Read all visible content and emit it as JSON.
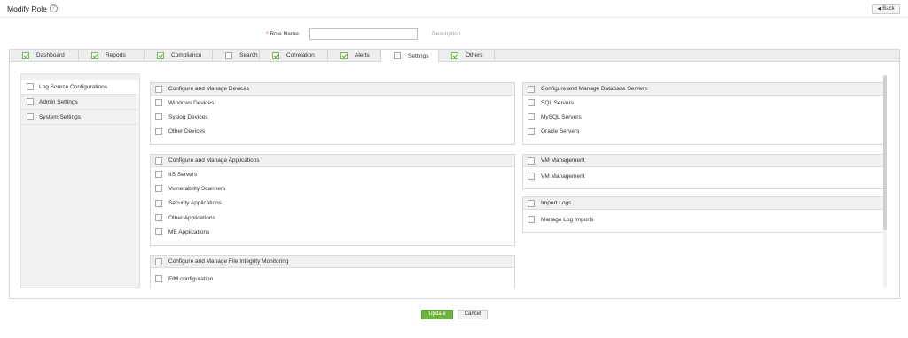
{
  "header": {
    "title": "Modify Role",
    "help_icon": "help-circle-icon",
    "back_label": "Back"
  },
  "role": {
    "name_label": "Role Name",
    "name_value": "",
    "description_label": "Description"
  },
  "tabs": [
    {
      "label": "Dashboard",
      "checked": true
    },
    {
      "label": "Reports",
      "checked": true
    },
    {
      "label": "Compliance",
      "checked": true
    },
    {
      "label": "Search",
      "checked": false
    },
    {
      "label": "Correlation",
      "checked": true
    },
    {
      "label": "Alerts",
      "checked": true
    },
    {
      "label": "Settings",
      "checked": false,
      "active": true
    },
    {
      "label": "Others",
      "checked": true
    }
  ],
  "sidebar": {
    "items": [
      {
        "label": "Log Source Configurations",
        "checked": false,
        "active": true
      },
      {
        "label": "Admin Settings",
        "checked": false
      },
      {
        "label": "System Settings",
        "checked": false
      }
    ]
  },
  "panels": {
    "devices": {
      "title": "Configure and Manage Devices",
      "items": [
        "Windows Devices",
        "Syslog Devices",
        "Other Devices"
      ]
    },
    "applications": {
      "title": "Configure and Manage Applications",
      "items": [
        "IIS Servers",
        "Vulnerability Scanners",
        "Security Applications",
        "Other Applications",
        "ME Applications"
      ]
    },
    "fim": {
      "title": "Configure and Manage File Integrity Monitoring",
      "items": [
        "FIM configuration"
      ]
    },
    "database": {
      "title": "Configure and Manage Database Servers",
      "items": [
        "SQL Servers",
        "MySQL Servers",
        "Oracle Servers"
      ]
    },
    "vm": {
      "title": "VM Management",
      "items": [
        "VM Management"
      ]
    },
    "import": {
      "title": "Import Logs",
      "items": [
        "Manage Log Imports"
      ]
    }
  },
  "footer": {
    "update_label": "Update",
    "cancel_label": "Cancel"
  },
  "colors": {
    "accent_green": "#6cb33f",
    "tab_bg": "#eceeef",
    "panel_head_bg": "#eef0f1"
  }
}
